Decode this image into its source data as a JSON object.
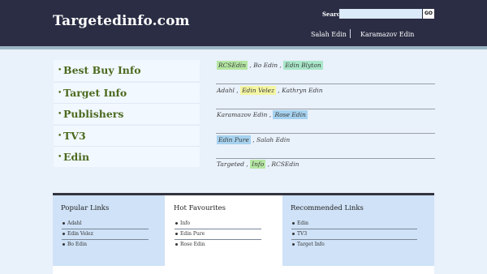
{
  "header": {
    "logo": "Targetedinfo.com",
    "search_label": "Search",
    "search_value": "",
    "go_label": "GO",
    "links": [
      "Salah Edin",
      "Karamazov Edin"
    ]
  },
  "menu": {
    "items": [
      {
        "bullet": "•",
        "label": "Best Buy Info"
      },
      {
        "bullet": "•",
        "label": "Target Info"
      },
      {
        "bullet": "•",
        "label": "Publishers"
      },
      {
        "bullet": "•",
        "label": "TV3"
      },
      {
        "bullet": "•",
        "label": "Edin"
      }
    ]
  },
  "tag_rows": [
    {
      "parts": [
        {
          "text": "RCSEdin",
          "highlight": "green"
        },
        {
          "text": " , ",
          "highlight": ""
        },
        {
          "text": "Bo Edin",
          "highlight": ""
        },
        {
          "text": " , ",
          "highlight": ""
        },
        {
          "text": "Edin Blyton",
          "highlight": "mint"
        }
      ]
    },
    {
      "parts": [
        {
          "text": "Adahl",
          "highlight": ""
        },
        {
          "text": " , ",
          "highlight": ""
        },
        {
          "text": "Edin Velez",
          "highlight": "yellow"
        },
        {
          "text": " , ",
          "highlight": ""
        },
        {
          "text": "Kathryn Edin",
          "highlight": ""
        }
      ]
    },
    {
      "parts": [
        {
          "text": "Karamazov Edin",
          "highlight": ""
        },
        {
          "text": " , ",
          "highlight": ""
        },
        {
          "text": "Rose Edin",
          "highlight": "blue"
        }
      ]
    },
    {
      "parts": [
        {
          "text": "Edin Pure",
          "highlight": "blue"
        },
        {
          "text": " , ",
          "highlight": ""
        },
        {
          "text": "Salah Edin",
          "highlight": ""
        }
      ]
    },
    {
      "parts": [
        {
          "text": "Targeted",
          "highlight": ""
        },
        {
          "text": " , ",
          "highlight": ""
        },
        {
          "text": "Info",
          "highlight": "green"
        },
        {
          "text": " , ",
          "highlight": ""
        },
        {
          "text": "RCSEdin",
          "highlight": ""
        }
      ]
    }
  ],
  "footer": {
    "columns": [
      {
        "title": "Popular Links",
        "items": [
          "Adahl",
          "Edin Velez",
          "Bo Edin"
        ]
      },
      {
        "title": "Hot Favourites",
        "items": [
          "Info",
          "Edin Pure",
          "Rose Edin"
        ]
      },
      {
        "title": "Recommended Links",
        "items": [
          "Edin",
          "TV3",
          "Target Info"
        ]
      }
    ]
  },
  "colors": {
    "header_bg": "#2b2d44",
    "menu_text": "#4b6a1e",
    "page_bg": "#e9f1fb",
    "highlight_green": "#b5e7a3",
    "highlight_yellow": "#f4f6a2",
    "highlight_blue": "#a6d2ef",
    "highlight_mint": "#a9e6c9"
  }
}
